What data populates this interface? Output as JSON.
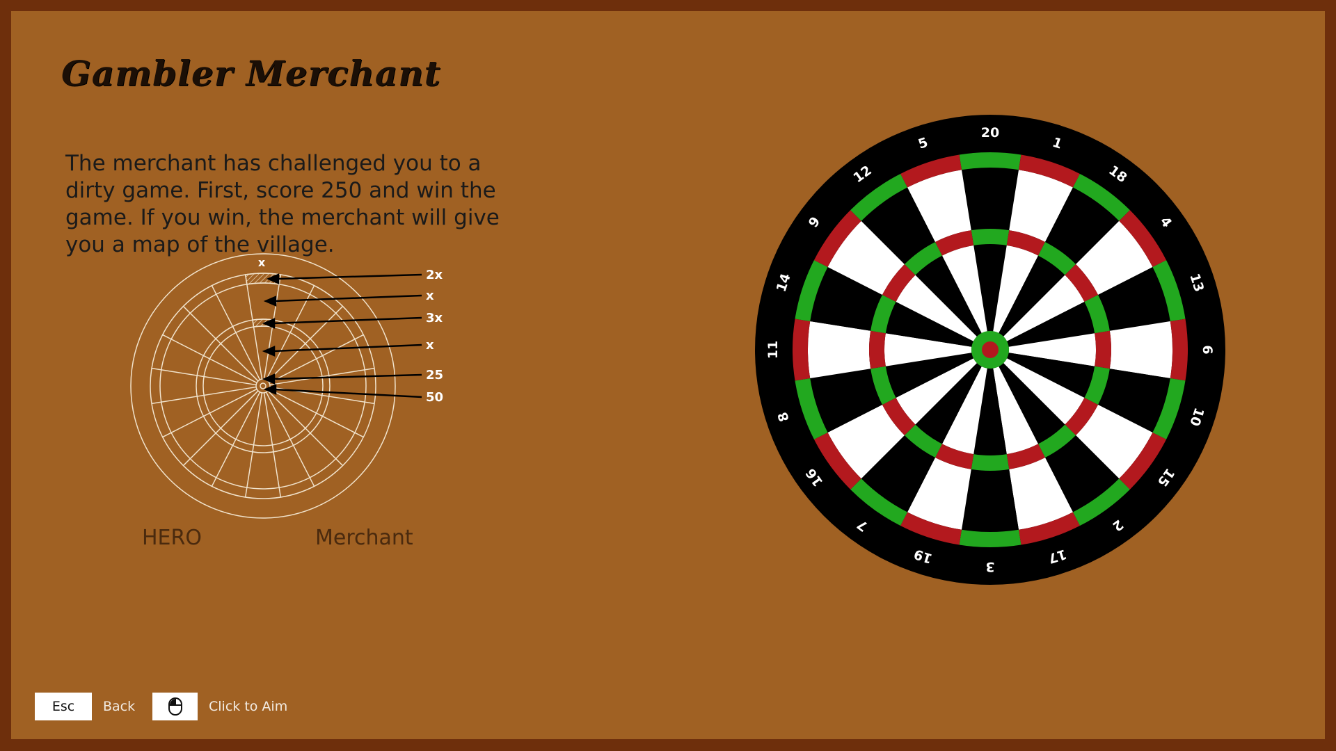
{
  "title": "Gambler Merchant",
  "description": "The merchant has challenged you to a dirty game. First, score 250 and win the game. If you win, the merchant will give you a map of the village.",
  "guide": {
    "top_marker": "x",
    "labels": [
      "2x",
      "x",
      "3x",
      "x",
      "25",
      "50"
    ]
  },
  "players": {
    "hero": "HERO",
    "opponent": "Merchant"
  },
  "dartboard": {
    "numbers": [
      "20",
      "1",
      "18",
      "4",
      "13",
      "6",
      "10",
      "15",
      "2",
      "17",
      "3",
      "19",
      "7",
      "16",
      "8",
      "11",
      "14",
      "9",
      "12",
      "5"
    ],
    "colors": {
      "black": "#000000",
      "white": "#ffffff",
      "red": "#b3191e",
      "green": "#22a81f"
    }
  },
  "controls": {
    "esc_key": "Esc",
    "back_label": "Back",
    "mouse_icon": "mouse-icon",
    "aim_label": "Click to Aim"
  },
  "theme": {
    "background": "#a06123",
    "border": "#6e2f0c"
  }
}
